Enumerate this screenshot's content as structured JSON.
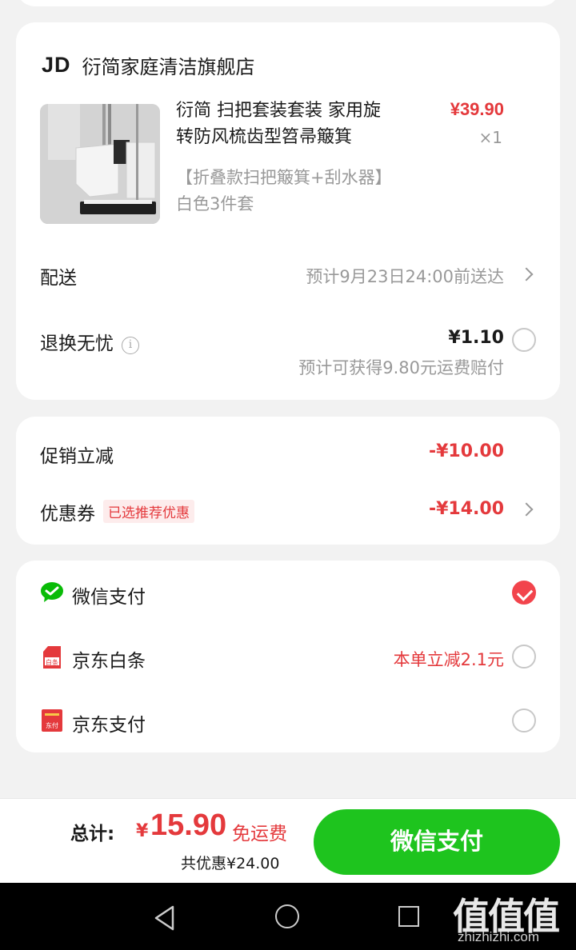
{
  "store": {
    "logo": "JD",
    "name": "衍简家庭清洁旗舰店",
    "product": {
      "title": "衍简 扫把套装套装 家用旋转防风梳齿型笤帚簸箕",
      "price": "¥39.90",
      "qty": "×1",
      "variant": "【折叠款扫把簸箕+刮水器】白色3件套"
    },
    "delivery": {
      "label": "配送",
      "value": "预计9月23日24:00前送达"
    },
    "return_insurance": {
      "label": "退换无忧",
      "price": "¥1.10",
      "note": "预计可获得9.80元运费赔付",
      "selected": false
    }
  },
  "promotions": {
    "promo": {
      "label": "促销立减",
      "value": "-¥10.00"
    },
    "coupon": {
      "label": "优惠券",
      "tag": "已选推荐优惠",
      "value": "-¥14.00"
    }
  },
  "payment_methods": [
    {
      "label": "微信支付",
      "icon": "wechat-pay-icon",
      "note": "",
      "selected": true
    },
    {
      "label": "京东白条",
      "icon": "jd-baitiao-icon",
      "icon_text": "白条",
      "note": "本单立减2.1元",
      "selected": false
    },
    {
      "label": "京东支付",
      "icon": "jd-pay-icon",
      "icon_text": "东付",
      "note": "",
      "selected": false
    }
  ],
  "footer": {
    "total_label": "总计:",
    "currency": "¥",
    "total": "15.90",
    "shipping": "免运费",
    "discount": "共优惠¥24.00",
    "pay_button": "微信支付"
  },
  "watermark": {
    "big": "值值值",
    "small": "zhizhizhi.com"
  },
  "colors": {
    "accent_red": "#e4393c",
    "pay_green": "#1ec41e",
    "wechat_green": "#09bb07"
  }
}
